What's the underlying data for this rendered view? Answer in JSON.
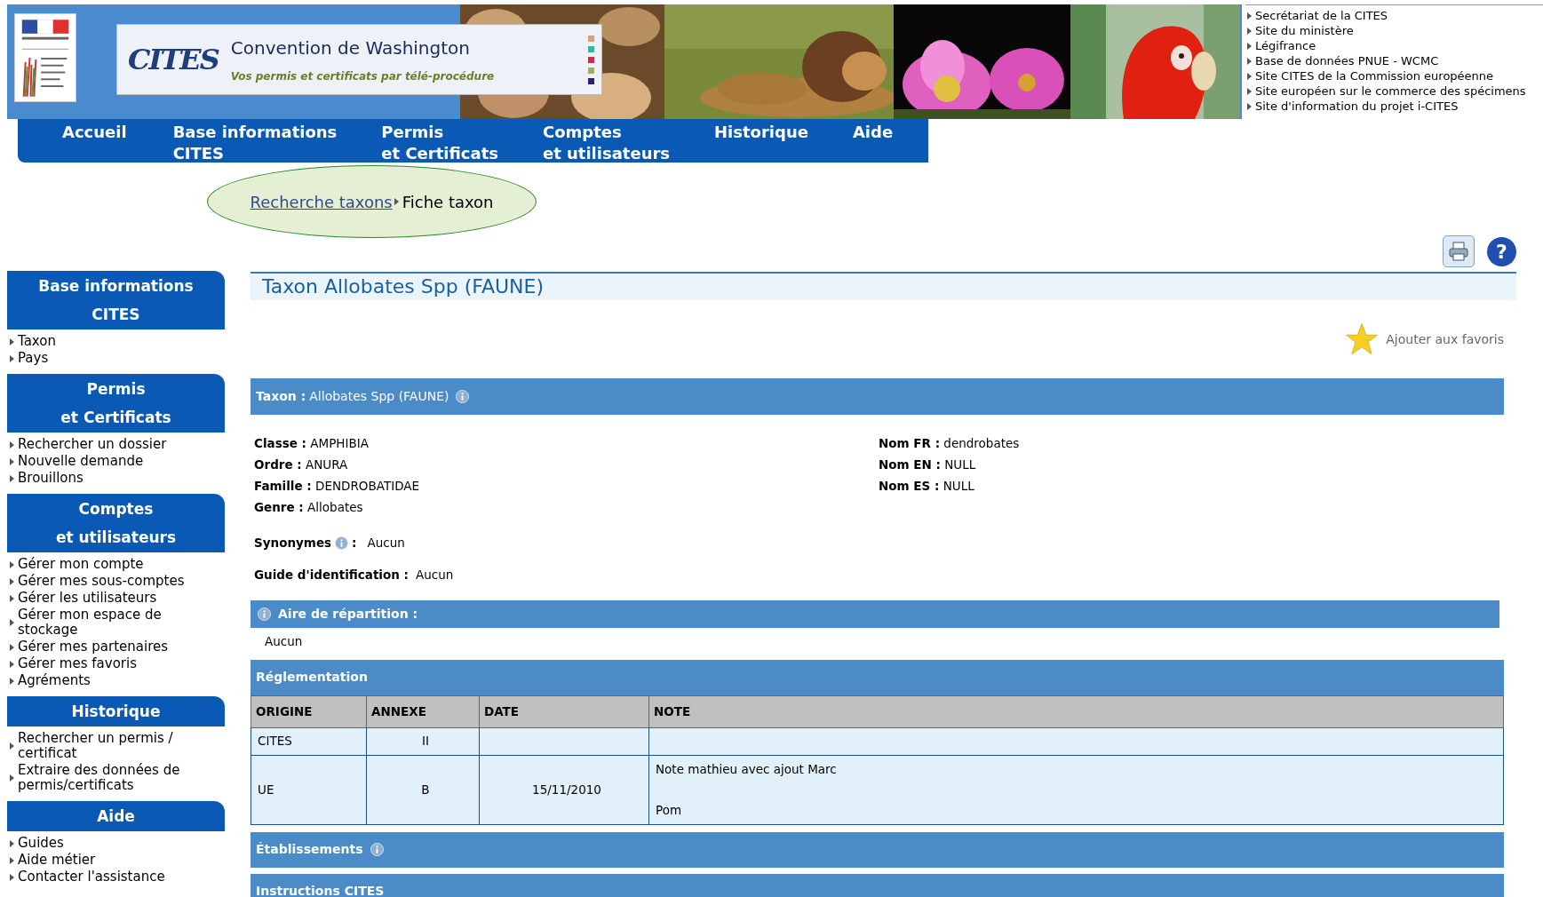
{
  "banner": {
    "logo": "CITES",
    "title": "Convention de Washington",
    "subtitle": "Vos permis et certificats par télé-procédure"
  },
  "external_links": [
    "Secrétariat de la CITES",
    "Site du ministère",
    "Légifrance",
    "Base de données PNUE - WCMC",
    "Site CITES de la Commission européenne",
    "Site européen sur le commerce des spécimens",
    "Site d'information du projet i-CITES"
  ],
  "nav": [
    {
      "lines": [
        "Accueil"
      ]
    },
    {
      "lines": [
        "Base informations",
        "CITES"
      ]
    },
    {
      "lines": [
        "Permis",
        "et Certificats"
      ]
    },
    {
      "lines": [
        "Comptes",
        "et utilisateurs"
      ]
    },
    {
      "lines": [
        "Historique"
      ]
    },
    {
      "lines": [
        "Aide"
      ]
    }
  ],
  "breadcrumb": [
    {
      "label": "Recherche taxons",
      "kind": "link"
    },
    {
      "label": "Fiche taxon",
      "kind": "current"
    }
  ],
  "help": "?",
  "sidebar": [
    {
      "title": [
        "Base informations",
        "CITES"
      ],
      "items": [
        "Taxon",
        "Pays"
      ]
    },
    {
      "title": [
        "Permis",
        "et Certificats"
      ],
      "items": [
        "Rechercher un dossier",
        "Nouvelle demande",
        "Brouillons"
      ]
    },
    {
      "title": [
        "Comptes",
        "et utilisateurs"
      ],
      "items": [
        "Gérer mon compte",
        "Gérer mes sous-comptes",
        "Gérer les utilisateurs",
        "Gérer mon espace de stockage",
        "Gérer mes partenaires",
        "Gérer mes favoris",
        "Agréments"
      ]
    },
    {
      "title": [
        "Historique"
      ],
      "items": [
        "Rechercher un permis / certificat",
        "Extraire des données de permis/certificats"
      ]
    },
    {
      "title": [
        "Aide"
      ],
      "items": [
        "Guides",
        "Aide métier",
        "Contacter l'assistance"
      ]
    }
  ],
  "page_title": "Taxon Allobates Spp (FAUNE)",
  "favorite": "Ajouter aux favoris",
  "taxon_bar": {
    "label": "Taxon :",
    "value": "Allobates Spp (FAUNE)"
  },
  "fields_left": [
    {
      "label": "Classe :",
      "value": "AMPHIBIA"
    },
    {
      "label": "Ordre :",
      "value": "ANURA"
    },
    {
      "label": "Famille :",
      "value": "DENDROBATIDAE"
    },
    {
      "label": "Genre :",
      "value": "Allobates"
    }
  ],
  "fields_right": [
    {
      "label": "Nom FR :",
      "value": "dendrobates"
    },
    {
      "label": "Nom EN :",
      "value": "NULL"
    },
    {
      "label": "Nom ES :",
      "value": "NULL"
    }
  ],
  "synonymes": {
    "label": "Synonymes",
    "colon": ":",
    "value": "Aucun"
  },
  "guide": {
    "label": "Guide d'identification :",
    "value": "Aucun"
  },
  "aire": {
    "title": "Aire de répartition :",
    "value": "Aucun"
  },
  "reglementation": {
    "title": "Réglementation",
    "columns": [
      "ORIGINE",
      "ANNEXE",
      "DATE",
      "NOTE"
    ],
    "rows": [
      {
        "origine": "CITES",
        "annexe": "II"
      },
      {
        "origine": "UE",
        "annexe": "B",
        "date": "15/11/2010",
        "note": [
          "Note mathieu avec ajout Marc",
          "Pom"
        ]
      }
    ]
  },
  "sections": [
    {
      "title": "Établissements",
      "info": true
    },
    {
      "title": "Instructions CITES",
      "info": false
    }
  ]
}
